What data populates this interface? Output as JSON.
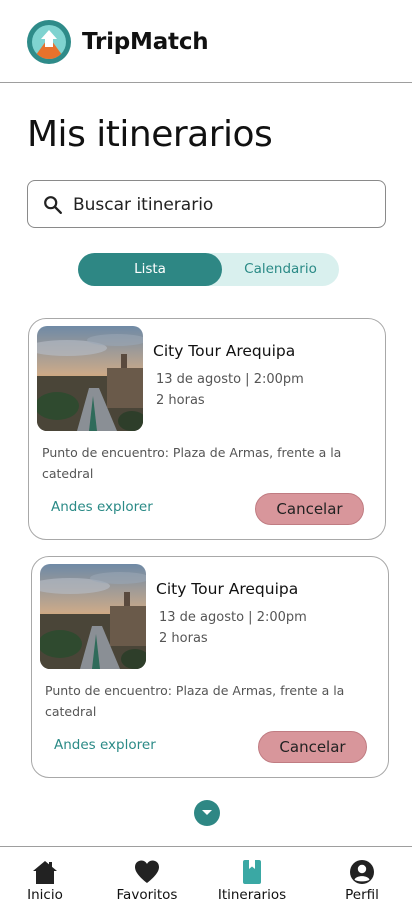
{
  "app": {
    "title": "TripMatch"
  },
  "page": {
    "title": "Mis itinerarios"
  },
  "search": {
    "placeholder": "Buscar itinerario",
    "value": ""
  },
  "view_toggle": {
    "options": [
      "Lista",
      "Calendario"
    ],
    "selected": "Lista"
  },
  "itineraries": [
    {
      "title": "City Tour Arequipa",
      "date": "13 de agosto | 2:00pm",
      "duration": "2 horas",
      "meeting_point": "Punto de encuentro: Plaza de Armas, frente a la catedral",
      "company": "Andes explorer",
      "cancel_label": "Cancelar"
    },
    {
      "title": "City Tour Arequipa",
      "date": "13 de agosto | 2:00pm",
      "duration": "2 horas",
      "meeting_point": "Punto de encuentro: Plaza de Armas, frente a la catedral",
      "company": "Andes explorer",
      "cancel_label": "Cancelar"
    }
  ],
  "bottom_nav": [
    {
      "label": "Inicio",
      "icon": "home-icon"
    },
    {
      "label": "Favoritos",
      "icon": "heart-icon"
    },
    {
      "label": "Itinerarios",
      "icon": "book-icon",
      "active": true
    },
    {
      "label": "Perfil",
      "icon": "person-icon"
    }
  ],
  "colors": {
    "primary": "#2e8784",
    "primary_light": "#d9f0ee",
    "cancel": "#d8969b",
    "link": "#2a8a86",
    "active_icon": "#3aa8a4"
  }
}
